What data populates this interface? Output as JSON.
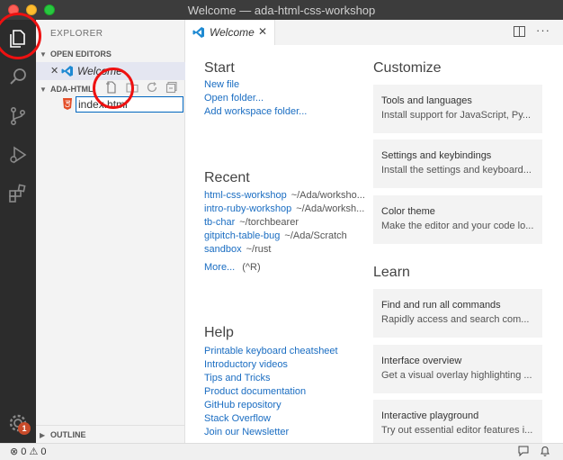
{
  "window": {
    "title": "Welcome — ada-html-css-workshop"
  },
  "activity_bar": {
    "items": [
      {
        "icon": "files-icon"
      },
      {
        "icon": "search-icon"
      },
      {
        "icon": "source-control-icon"
      },
      {
        "icon": "debug-icon"
      },
      {
        "icon": "extensions-icon"
      }
    ],
    "manage_badge": "1"
  },
  "sidebar": {
    "title": "EXPLORER",
    "open_editors_header": "OPEN EDITORS",
    "open_editor_item": "Welcome",
    "folder_header": "ADA-HTML",
    "new_file_input_value": "index.html",
    "outline_header": "OUTLINE"
  },
  "tabs": [
    {
      "label": "Welcome",
      "active": true
    }
  ],
  "welcome": {
    "start": {
      "heading": "Start",
      "links": [
        "New file",
        "Open folder...",
        "Add workspace folder..."
      ]
    },
    "recent": {
      "heading": "Recent",
      "items": [
        {
          "name": "html-css-workshop",
          "path": "~/Ada/worksho..."
        },
        {
          "name": "intro-ruby-workshop",
          "path": "~/Ada/worksh..."
        },
        {
          "name": "tb-char",
          "path": "~/torchbearer"
        },
        {
          "name": "gitpitch-table-bug",
          "path": "~/Ada/Scratch"
        },
        {
          "name": "sandbox",
          "path": "~/rust"
        }
      ],
      "more_label": "More...",
      "more_shortcut": "(^R)"
    },
    "help": {
      "heading": "Help",
      "links": [
        "Printable keyboard cheatsheet",
        "Introductory videos",
        "Tips and Tricks",
        "Product documentation",
        "GitHub repository",
        "Stack Overflow",
        "Join our Newsletter"
      ]
    },
    "customize": {
      "heading": "Customize",
      "cards": [
        {
          "title": "Tools and languages",
          "desc": "Install support for JavaScript, Py..."
        },
        {
          "title": "Settings and keybindings",
          "desc": "Install the settings and keyboard..."
        },
        {
          "title": "Color theme",
          "desc": "Make the editor and your code lo..."
        }
      ]
    },
    "learn": {
      "heading": "Learn",
      "cards": [
        {
          "title": "Find and run all commands",
          "desc": "Rapidly access and search com..."
        },
        {
          "title": "Interface overview",
          "desc": "Get a visual overlay highlighting ..."
        },
        {
          "title": "Interactive playground",
          "desc": "Try out essential editor features i..."
        }
      ]
    }
  },
  "statusbar": {
    "errors": "0",
    "warnings": "0"
  },
  "colors": {
    "link": "#1a6dc2",
    "accent": "#0066bf",
    "annotation_circle": "#ee1111"
  }
}
